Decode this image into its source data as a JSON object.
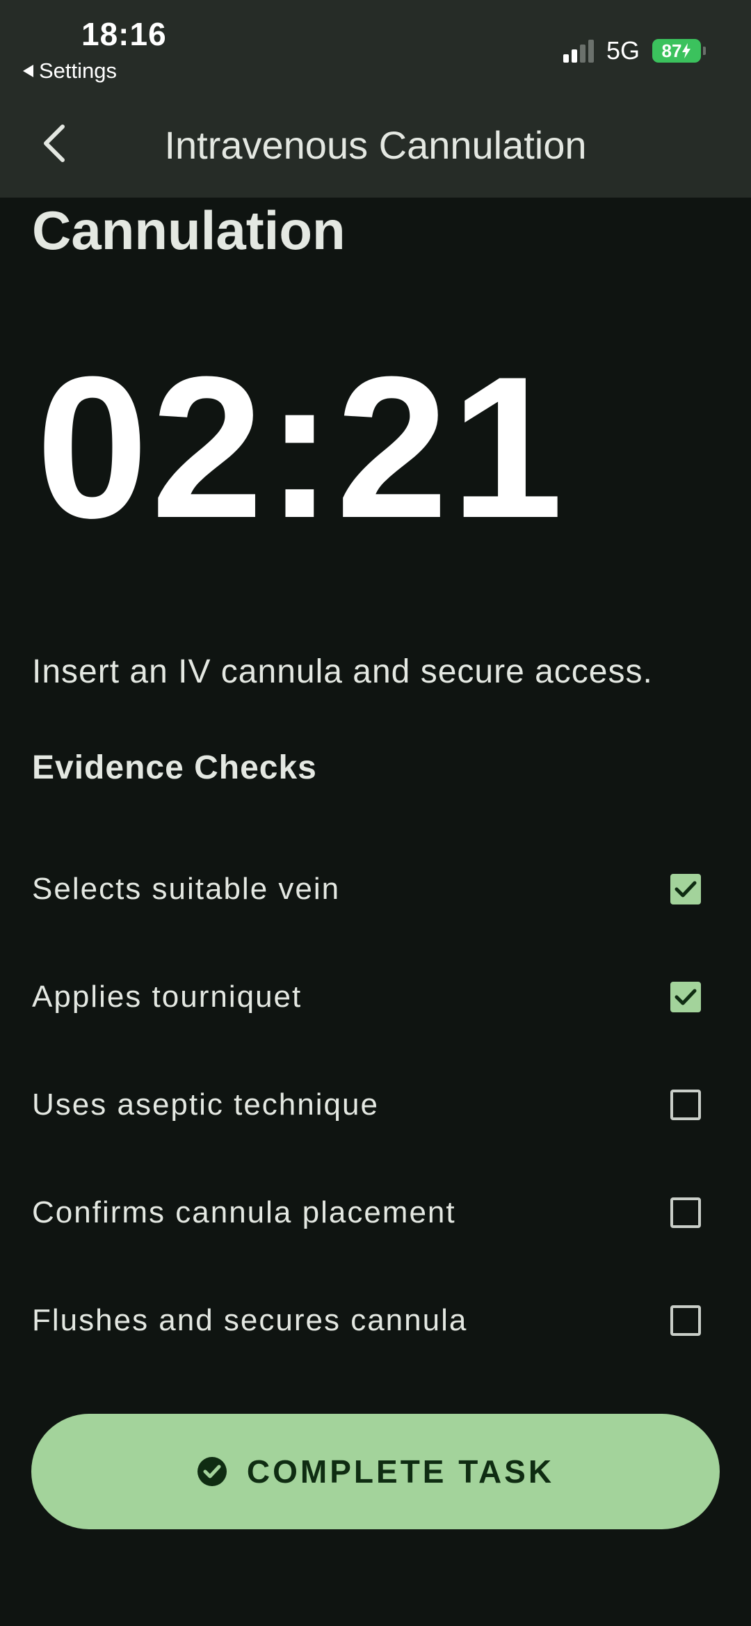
{
  "status_bar": {
    "time": "18:16",
    "back_app": "Settings",
    "network": "5G",
    "battery": "87"
  },
  "nav": {
    "title": "Intravenous Cannulation"
  },
  "page": {
    "heading": "Cannulation",
    "timer": "02:21",
    "description": "Insert an IV cannula and secure access.",
    "section_title": "Evidence Checks"
  },
  "checks": [
    {
      "label": "Selects suitable vein",
      "checked": true
    },
    {
      "label": "Applies tourniquet",
      "checked": true
    },
    {
      "label": "Uses aseptic technique",
      "checked": false
    },
    {
      "label": "Confirms cannula placement",
      "checked": false
    },
    {
      "label": "Flushes and secures cannula",
      "checked": false
    }
  ],
  "action": {
    "label": "COMPLETE TASK"
  },
  "colors": {
    "background": "#0f1411",
    "header": "#262c27",
    "accent": "#a3d39b",
    "battery": "#3bc25d"
  },
  "icons": {
    "back": "chevron-left-icon",
    "check": "checkmark-icon",
    "complete": "check-circle-icon"
  }
}
